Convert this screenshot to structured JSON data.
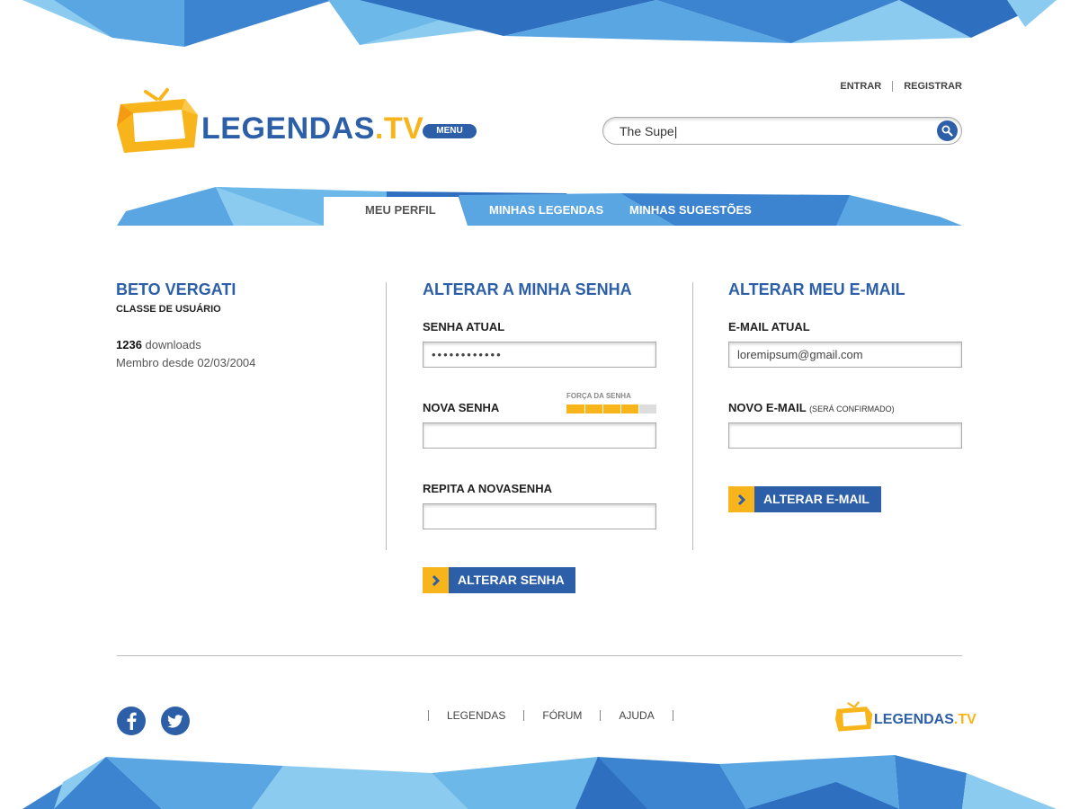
{
  "brand": {
    "logo_main": "LEGENDAS",
    "logo_dot": ".",
    "logo_tv": "TV",
    "primary_color": "#2c5fa8",
    "accent_color": "#f8b51b"
  },
  "header": {
    "menu_label": "MENU",
    "login_label": "ENTRAR",
    "register_label": "REGISTRAR",
    "search_value": "The Supe|",
    "search_icon": "search-icon"
  },
  "nav": {
    "tabs": [
      {
        "label": "MEU PERFIL",
        "active": true
      },
      {
        "label": "MINHAS LEGENDAS",
        "active": false
      },
      {
        "label": "MINHAS SUGESTÕES",
        "active": false
      }
    ]
  },
  "profile": {
    "name": "BETO VERGATI",
    "user_class": "CLASSE DE USUÁRIO",
    "downloads_count": "1236",
    "downloads_label": " downloads",
    "member_since": "Membro desde 02/03/2004"
  },
  "password_section": {
    "title": "ALTERAR A MINHA SENHA",
    "current_label": "SENHA ATUAL",
    "current_value": "••••••••••••",
    "new_label": "NOVA SENHA",
    "strength_label": "FORÇA DA SENHA",
    "strength_level": 0.8,
    "repeat_label": "REPITA A NOVASENHA",
    "submit_label": "ALTERAR SENHA"
  },
  "email_section": {
    "title": "ALTERAR MEU E-MAIL",
    "current_label": "E-MAIL ATUAL",
    "current_value": "loremipsum@gmail.com",
    "new_label": "NOVO E-MAIL",
    "new_note": "(SERÁ CONFIRMADO)",
    "submit_label": "ALTERAR E-MAIL"
  },
  "footer": {
    "links": [
      "LEGENDAS",
      "FÓRUM",
      "AJUDA"
    ],
    "social": [
      "facebook-icon",
      "twitter-icon"
    ]
  }
}
